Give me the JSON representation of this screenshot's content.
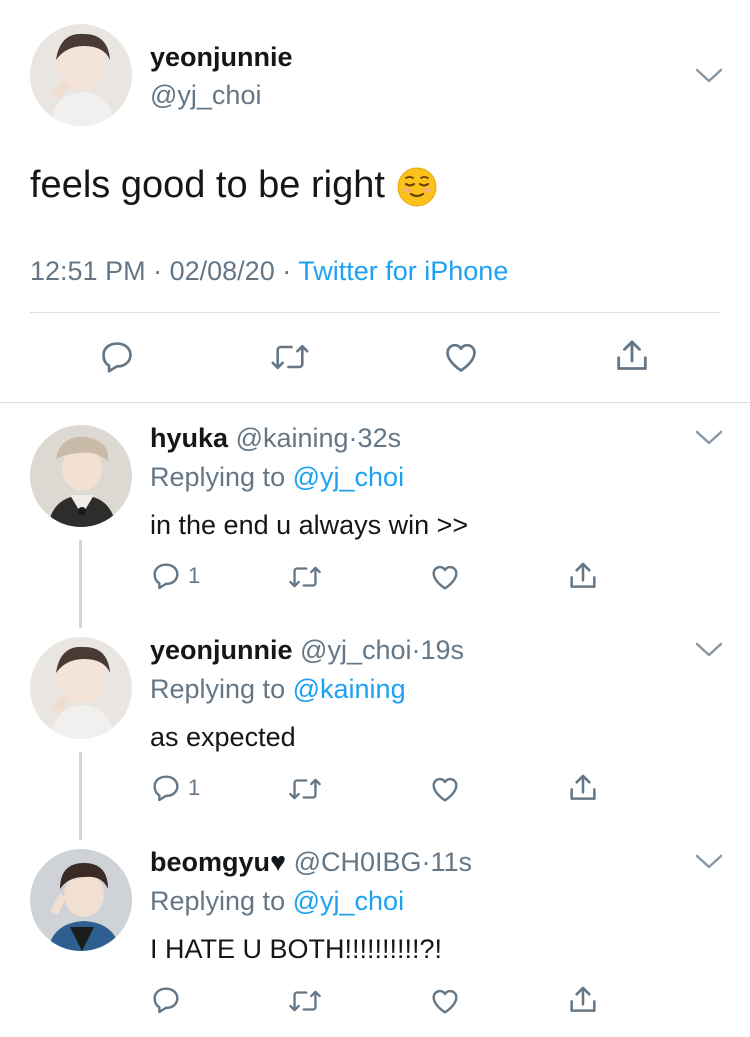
{
  "main_tweet": {
    "name": "yeonjunnie",
    "handle": "@yj_choi",
    "text": "feels good to be right",
    "emoji": "relieved-face",
    "time": "12:51 PM",
    "sep1": "·",
    "date": "02/08/20",
    "sep2": "·",
    "source": "Twitter for iPhone"
  },
  "replies": [
    {
      "name": "hyuka",
      "handle": "@kaining",
      "dot": "·",
      "age": "32s",
      "replying_prefix": "Replying to",
      "replying_to": "@yj_choi",
      "text": "in the end u always win >>",
      "reply_count": "1"
    },
    {
      "name": "yeonjunnie",
      "handle": "@yj_choi",
      "dot": "·",
      "age": "19s",
      "replying_prefix": "Replying to",
      "replying_to": "@kaining",
      "text": "as expected",
      "reply_count": "1"
    },
    {
      "name": "beomgyu",
      "name_suffix": "♥",
      "handle": "@CH0IBG",
      "dot": "·",
      "age": "11s",
      "replying_prefix": "Replying to",
      "replying_to": "@yj_choi",
      "text": "I HATE U BOTH!!!!!!!!!!?!",
      "reply_count": ""
    }
  ],
  "colors": {
    "link": "#1da1f2",
    "secondary_text": "#657786",
    "divider": "#d9dee2",
    "icon": "#657786"
  }
}
